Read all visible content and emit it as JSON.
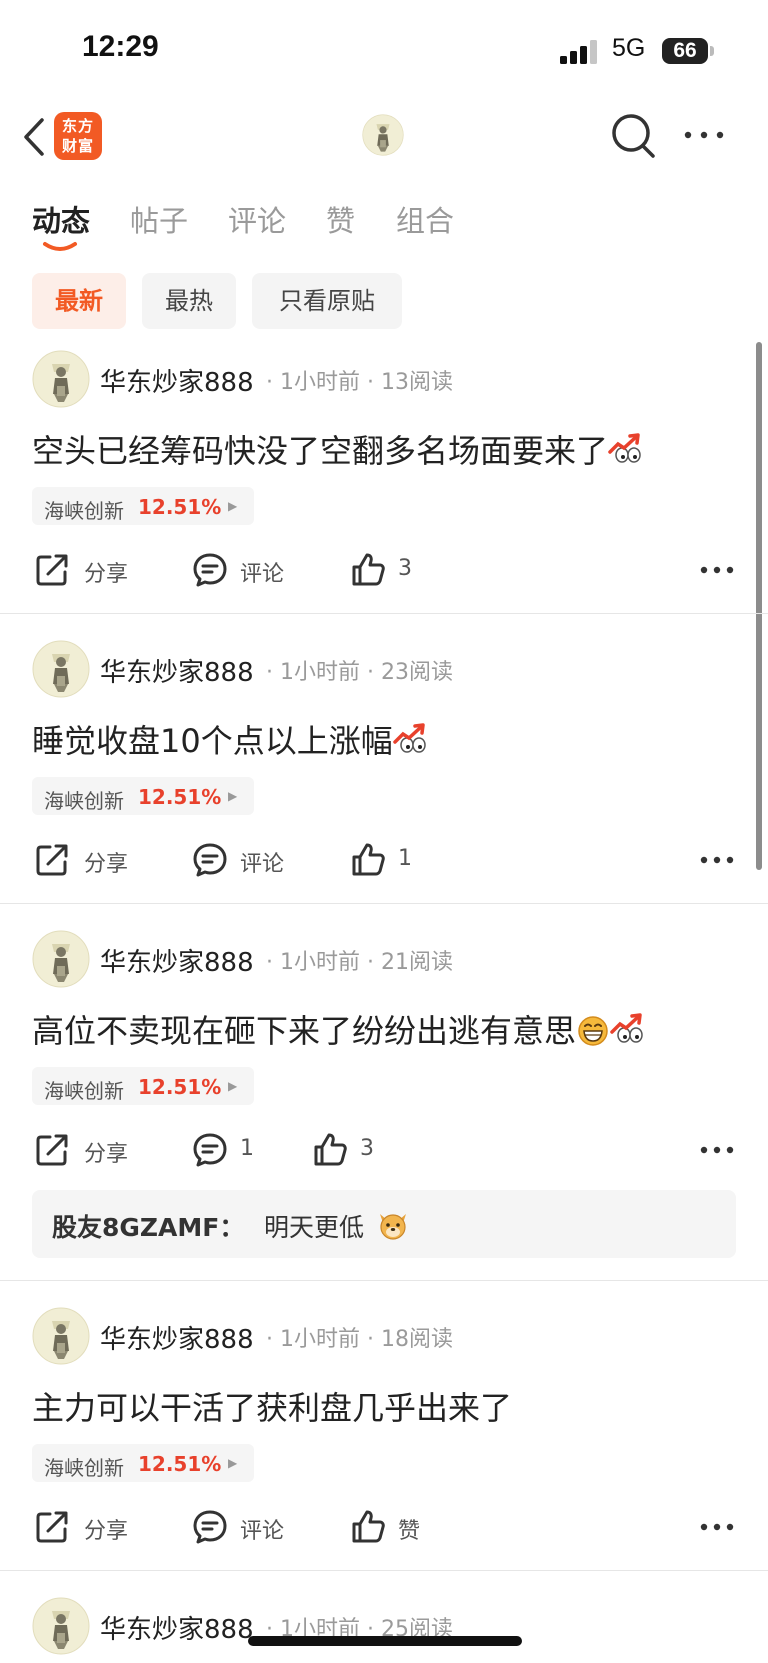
{
  "status_bar": {
    "time": "12:29",
    "network": "5G",
    "battery": "66"
  },
  "header": {
    "logo_line1": "东方",
    "logo_line2": "财富"
  },
  "tabs": [
    {
      "label": "动态",
      "active": true
    },
    {
      "label": "帖子",
      "active": false
    },
    {
      "label": "评论",
      "active": false
    },
    {
      "label": "赞",
      "active": false
    },
    {
      "label": "组合",
      "active": false
    }
  ],
  "filters": [
    {
      "label": "最新",
      "active": true
    },
    {
      "label": "最热",
      "active": false
    },
    {
      "label": "只看原贴",
      "active": false
    }
  ],
  "posts": [
    {
      "author": "华东炒家888",
      "time": "1小时前",
      "reads": "13阅读",
      "content": "空头已经筹码快没了空翻多名场面要来了",
      "stock": {
        "name": "海峡创新",
        "change": "12.51%"
      },
      "share_label": "分享",
      "comment_label": "评论",
      "like_label": "3"
    },
    {
      "author": "华东炒家888",
      "time": "1小时前",
      "reads": "23阅读",
      "content": "睡觉收盘10个点以上涨幅",
      "stock": {
        "name": "海峡创新",
        "change": "12.51%"
      },
      "share_label": "分享",
      "comment_label": "评论",
      "like_label": "1"
    },
    {
      "author": "华东炒家888",
      "time": "1小时前",
      "reads": "21阅读",
      "content": "高位不卖现在砸下来了纷纷出逃有意思",
      "stock": {
        "name": "海峡创新",
        "change": "12.51%"
      },
      "share_label": "分享",
      "comment_label": "1",
      "like_label": "3",
      "reply": {
        "user": "股友8GZAMF：",
        "text": "明天更低"
      }
    },
    {
      "author": "华东炒家888",
      "time": "1小时前",
      "reads": "18阅读",
      "content": "主力可以干活了获利盘几乎出来了",
      "stock": {
        "name": "海峡创新",
        "change": "12.51%"
      },
      "share_label": "分享",
      "comment_label": "评论",
      "like_label": "赞"
    },
    {
      "author": "华东炒家888",
      "time": "1小时前",
      "reads": "25阅读"
    }
  ],
  "colors": {
    "accent": "#f25a24",
    "stock_up": "#e8412c"
  },
  "icons": [
    "back-arrow-icon",
    "search-icon",
    "more-icon",
    "share-icon",
    "comment-icon",
    "like-icon",
    "stock-up-emoji-icon",
    "grin-emoji-icon",
    "dog-emoji-icon"
  ]
}
